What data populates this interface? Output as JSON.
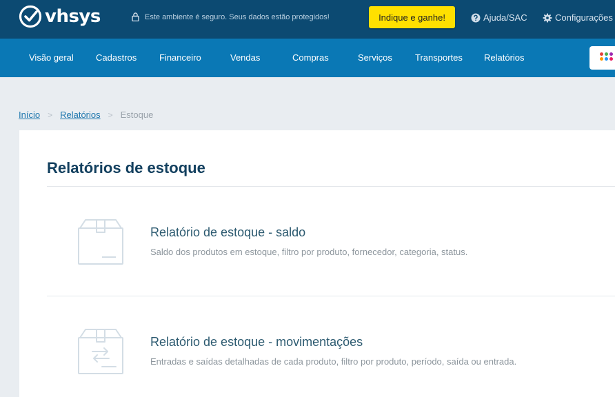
{
  "brand": {
    "name": "vhsys"
  },
  "topbar": {
    "secure_text": "Este ambiente é seguro. Seus dados estão protegidos!",
    "indique_label": "Indique e ganhe!",
    "help_label": "Ajuda/SAC",
    "config_label": "Configurações"
  },
  "nav": {
    "items": [
      {
        "label": "Visão geral"
      },
      {
        "label": "Cadastros"
      },
      {
        "label": "Financeiro"
      },
      {
        "label": "Vendas"
      },
      {
        "label": "Compras"
      },
      {
        "label": "Serviços"
      },
      {
        "label": "Transportes"
      },
      {
        "label": "Relatórios"
      }
    ],
    "apps_icon": "apps-grid-icon",
    "apps_colors": [
      "#e5403a",
      "#4caf50",
      "#9c27b0",
      "#ff9800",
      "#2196f3",
      "#e91e63"
    ]
  },
  "breadcrumb": {
    "home": "Início",
    "section": "Relatórios",
    "current": "Estoque",
    "separator": ">"
  },
  "page": {
    "title": "Relatórios de estoque",
    "reports": [
      {
        "icon": "box-icon",
        "title": "Relatório de estoque - saldo",
        "description": "Saldo dos produtos em estoque, filtro por produto, fornecedor, categoria, status."
      },
      {
        "icon": "box-transfer-icon",
        "title": "Relatório de estoque - movimentações",
        "description": "Entradas e saídas detalhadas de cada produto, filtro por produto, período, saída ou entrada."
      }
    ]
  },
  "colors": {
    "topbar": "#0c4a72",
    "navbar": "#0a78b5",
    "cta": "#ffe000",
    "background": "#e9edf1"
  }
}
